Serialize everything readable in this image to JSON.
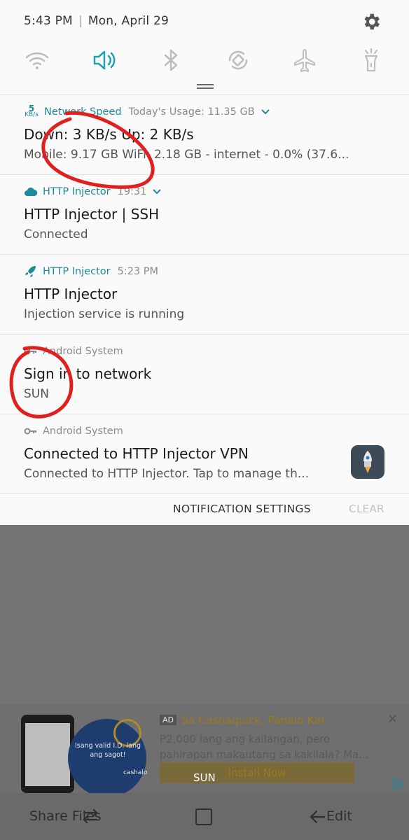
{
  "status_bar": {
    "time": "5:43 PM",
    "date": "Mon, April 29"
  },
  "quick_settings": {
    "icons": [
      "wifi-icon",
      "sound-icon",
      "bluetooth-icon",
      "auto-rotate-icon",
      "airplane-icon",
      "flashlight-icon"
    ],
    "active": "sound-icon",
    "accent": "#1f9fb0"
  },
  "notifications": [
    {
      "app": "Network Speed",
      "meta": "Today's Usage: 11.35 GB",
      "title": "Down: 3 KB/s Up: 2 KB/s",
      "text": "Mobile: 9.17 GB WiFi: 2.18 GB - internet - 0.0% (37.6...",
      "badge": {
        "num": "5",
        "unit": "KB/s"
      }
    },
    {
      "app": "HTTP Injector",
      "meta": "19:31",
      "title": "HTTP Injector | SSH",
      "text": "Connected"
    },
    {
      "app": "HTTP Injector",
      "meta": "5:23 PM",
      "title": "HTTP Injector",
      "text": "Injection service is running"
    },
    {
      "app": "Android System",
      "meta": "",
      "title": "Sign in to network",
      "text": "SUN"
    },
    {
      "app": "Android System",
      "meta": "",
      "title": "Connected to HTTP Injector VPN",
      "text": "Connected to HTTP Injector. Tap to manage th..."
    }
  ],
  "actions": {
    "settings": "NOTIFICATION SETTINGS",
    "clear": "CLEAR"
  },
  "ad": {
    "tag": "AD",
    "title": "Sa Cashaquick, Panalo Ka!",
    "description": "P2,000 lang ang kailangan, pero pahirapan makautang sa kakilala? Ma...",
    "button": "Install Now",
    "image_text": "Isang valid I.D. lang ang sagot!",
    "brand": "cashalo"
  },
  "toast": "SUN",
  "nav": {
    "left": "Share Files",
    "right": "Edit"
  }
}
